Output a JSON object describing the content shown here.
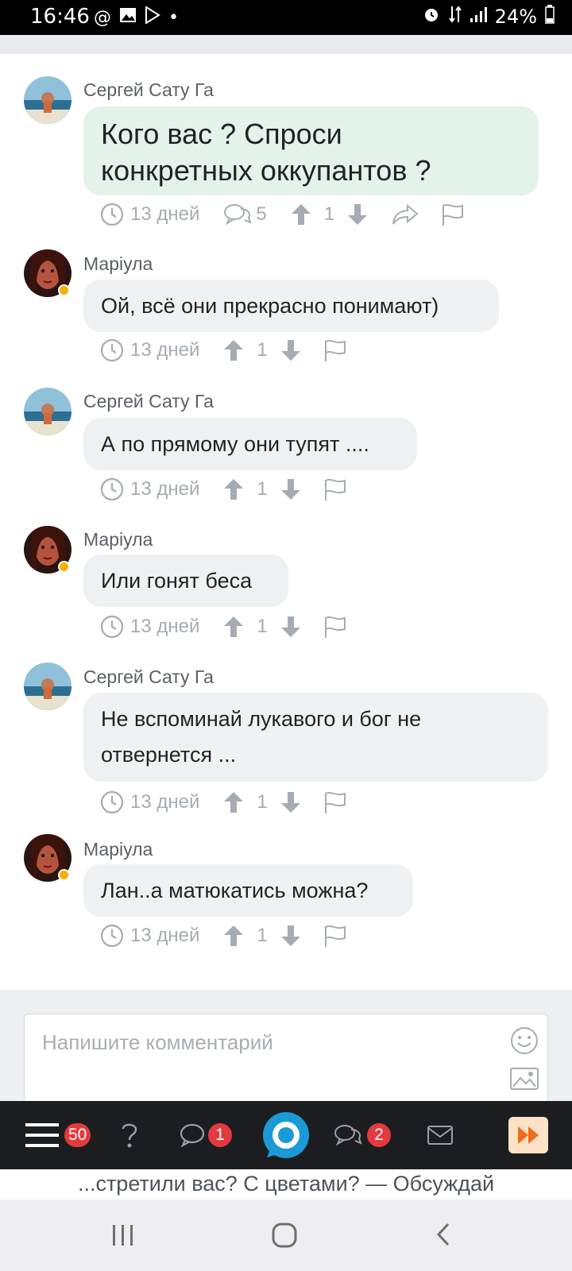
{
  "status_bar": {
    "time": "16:46",
    "battery": "24%"
  },
  "comments": [
    {
      "author": "Сергей Сату Га",
      "text_lines": [
        "Кого вас ? Спроси",
        "конкретных оккупантов ?"
      ],
      "time": "13 дней",
      "replies": "5",
      "votes": "1",
      "highlight": true
    },
    {
      "author": "Маріула",
      "text_lines": [
        "Ой, всё они прекрасно понимают)"
      ],
      "time": "13 дней",
      "votes": "1"
    },
    {
      "author": "Сергей Сату Га",
      "text_lines": [
        "А по прямому они тупят ...."
      ],
      "time": "13 дней",
      "votes": "1"
    },
    {
      "author": "Маріула",
      "text_lines": [
        "Или гонят беса"
      ],
      "time": "13 дней",
      "votes": "1"
    },
    {
      "author": "Сергей Сату Га",
      "text_lines": [
        "Не вспоминай лукавого и бог не",
        "отвернется ..."
      ],
      "time": "13 дней",
      "votes": "1"
    },
    {
      "author": "Маріула",
      "text_lines": [
        "Лан..а матюкатись можна?"
      ],
      "time": "13 дней",
      "votes": "1"
    }
  ],
  "comment_input": {
    "placeholder": "Напишите комментарий"
  },
  "bottom_nav": {
    "menu_badge": "50",
    "messages_badge": "1",
    "discussions_badge": "2"
  },
  "ticker": {
    "text": "...стретили вас? С цветами? — Обсуждай"
  },
  "colors": {
    "accent_blue": "#1b9ad6",
    "badge_red": "#e23a3f",
    "highlight_bubble": "#e4f3ea",
    "forward_orange": "#f26a1b"
  }
}
